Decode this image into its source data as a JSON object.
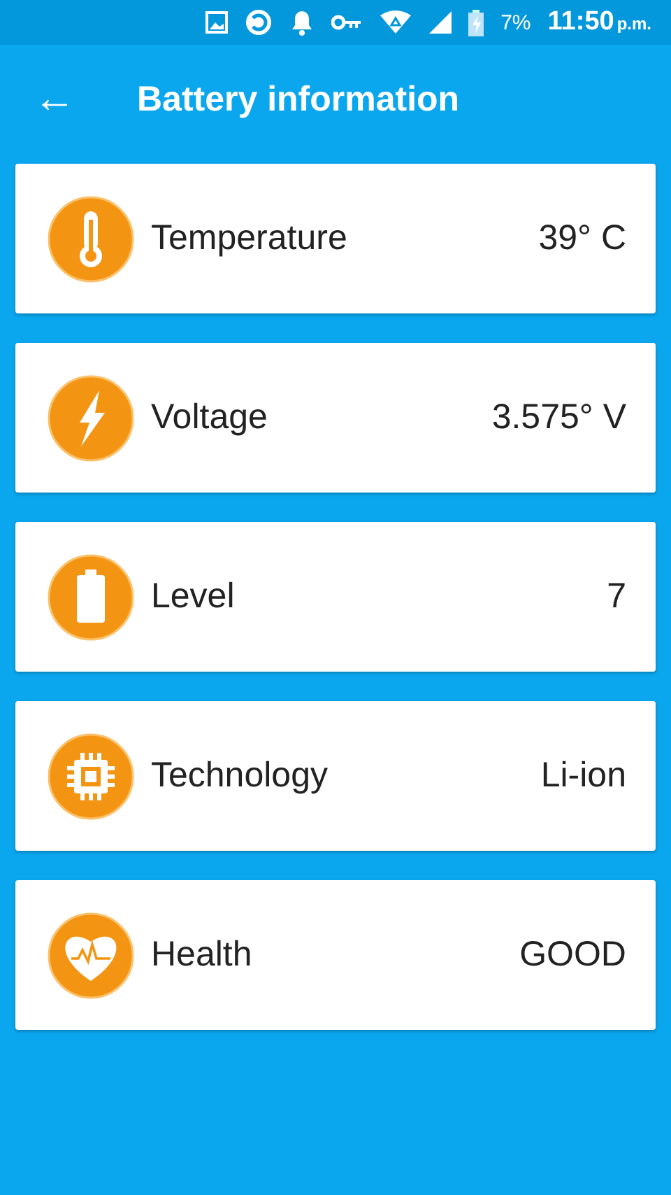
{
  "status_bar": {
    "battery_percent": "7%",
    "time": "11:50",
    "time_suffix": "p.m."
  },
  "app_bar": {
    "back_icon": "←",
    "title": "Battery information"
  },
  "items": [
    {
      "kind": "temperature",
      "label": "Temperature",
      "value": "39° C"
    },
    {
      "kind": "voltage",
      "label": "Voltage",
      "value": "3.575° V"
    },
    {
      "kind": "level",
      "label": "Level",
      "value": "7"
    },
    {
      "kind": "technology",
      "label": "Technology",
      "value": "Li-ion"
    },
    {
      "kind": "health",
      "label": "Health",
      "value": "GOOD"
    }
  ]
}
